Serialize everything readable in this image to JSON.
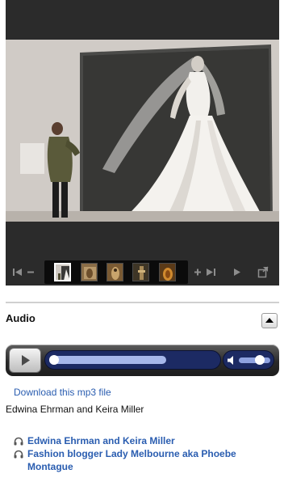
{
  "gallery": {
    "controls": {
      "first": "first-photo",
      "zoom_out": "zoom-out",
      "zoom_in": "zoom-in",
      "next": "next-photo",
      "play": "play-slideshow",
      "fullscreen": "open-fullscreen"
    },
    "thumbnails": [
      "photo-1",
      "photo-2",
      "photo-3",
      "photo-4",
      "photo-5"
    ],
    "selected_index": 0
  },
  "audio": {
    "section_title": "Audio",
    "player": {
      "buffered_fraction": 0.7,
      "played_fraction": 0.0,
      "volume_fraction": 0.75
    },
    "download_label": "Download this mp3 file",
    "caption": "Edwina Ehrman and Keira Miller",
    "tracks": [
      "Edwina Ehrman and Keira Miller",
      "Fashion blogger Lady Melbourne aka Phoebe Montague"
    ]
  },
  "colors": {
    "link": "#2a5db0",
    "player_track": "#1c2a63",
    "viewer_bg": "#2b2b2b"
  }
}
